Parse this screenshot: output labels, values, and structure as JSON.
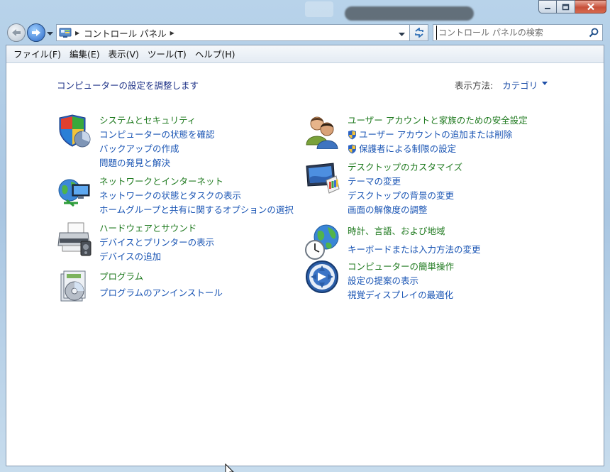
{
  "window": {
    "caption_buttons": [
      "minimize-icon",
      "maximize-icon",
      "close-icon"
    ]
  },
  "nav": {
    "breadcrumb": "コントロール パネル",
    "search_placeholder": "コントロール パネルの検索"
  },
  "menu": {
    "items": [
      "ファイル(F)",
      "編集(E)",
      "表示(V)",
      "ツール(T)",
      "ヘルプ(H)"
    ]
  },
  "main": {
    "heading": "コンピューターの設定を調整します",
    "view_by_label": "表示方法:",
    "view_by_value": "カテゴリ",
    "categories": [
      {
        "icon": "shield-icon",
        "title": "システムとセキュリティ",
        "links": [
          "コンピューターの状態を確認",
          "バックアップの作成",
          "問題の発見と解決"
        ]
      },
      {
        "icon": "network-icon",
        "title": "ネットワークとインターネット",
        "links": [
          "ネットワークの状態とタスクの表示",
          "ホームグループと共有に関するオプションの選択"
        ]
      },
      {
        "icon": "printer-icon",
        "title": "ハードウェアとサウンド",
        "links": [
          "デバイスとプリンターの表示",
          "デバイスの追加"
        ]
      },
      {
        "icon": "programs-icon",
        "title": "プログラム",
        "links": [
          "プログラムのアンインストール"
        ]
      },
      {
        "icon": "users-icon",
        "title": "ユーザー アカウントと家族のための安全設定",
        "links": [
          "ユーザー アカウントの追加または削除",
          "保護者による制限の設定"
        ]
      },
      {
        "icon": "display-icon",
        "title": "デスクトップのカスタマイズ",
        "links": [
          "テーマの変更",
          "デスクトップの背景の変更",
          "画面の解像度の調整"
        ]
      },
      {
        "icon": "clock-globe-icon",
        "title": "時計、言語、および地域",
        "links": [
          "キーボードまたは入力方法の変更"
        ]
      },
      {
        "icon": "ease-of-access-icon",
        "title": "コンピューターの簡単操作",
        "links": [
          "設定の提案の表示",
          "視覚ディスプレイの最適化"
        ]
      }
    ]
  },
  "colors": {
    "category_title": "#1f7a1f",
    "link": "#1a55b4",
    "heading": "#1e3287"
  }
}
